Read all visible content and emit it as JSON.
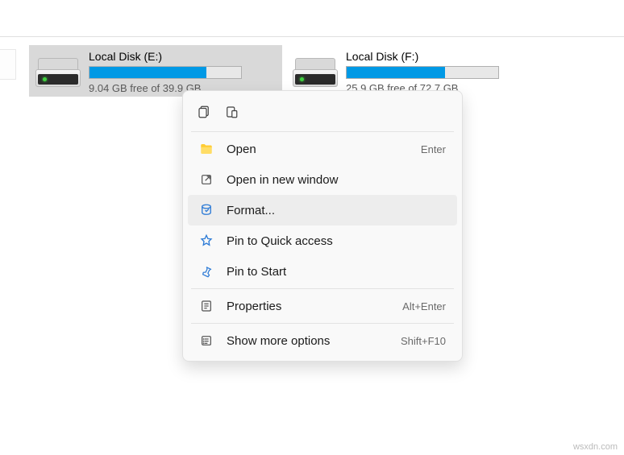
{
  "drives": [
    {
      "name": "Local Disk (E:)",
      "status": "9.04 GB free of 39.9 GB",
      "fill_percent": 77
    },
    {
      "name": "Local Disk (F:)",
      "status": "25.9 GB free of 72.7 GB",
      "fill_percent": 65
    }
  ],
  "context_menu": {
    "open": {
      "label": "Open",
      "shortcut": "Enter"
    },
    "open_new_window": {
      "label": "Open in new window"
    },
    "format": {
      "label": "Format..."
    },
    "pin_quick": {
      "label": "Pin to Quick access"
    },
    "pin_start": {
      "label": "Pin to Start"
    },
    "properties": {
      "label": "Properties",
      "shortcut": "Alt+Enter"
    },
    "more_options": {
      "label": "Show more options",
      "shortcut": "Shift+F10"
    }
  },
  "watermark": "wsxdn.com"
}
